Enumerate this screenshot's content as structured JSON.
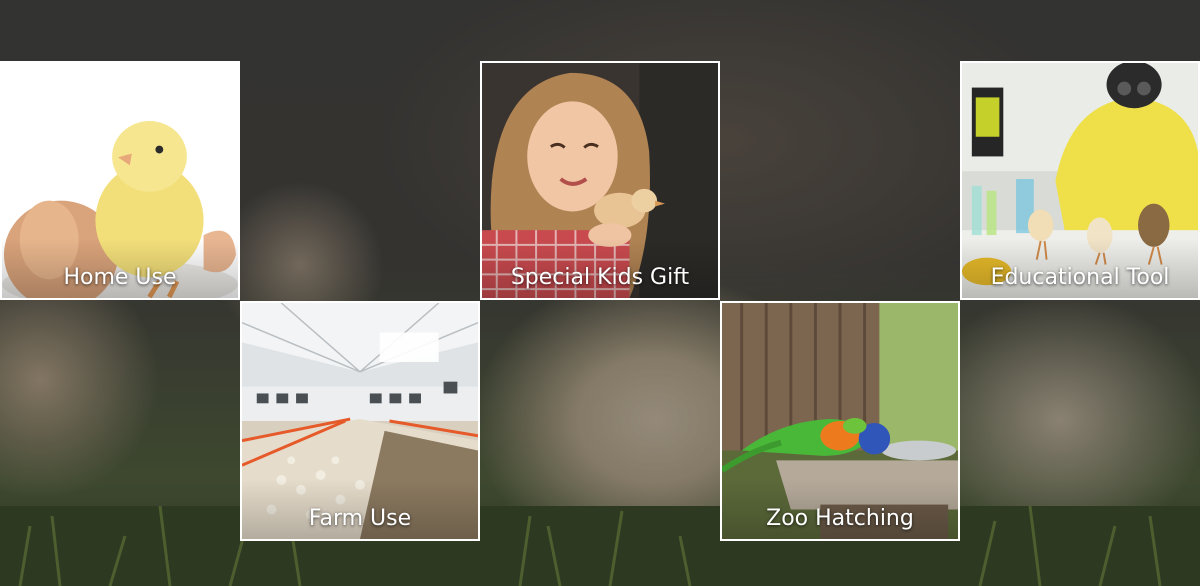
{
  "tiles": {
    "home": {
      "label": "Home Use"
    },
    "kids": {
      "label": "Special Kids Gift"
    },
    "edu": {
      "label": "Educational Tool"
    },
    "farm": {
      "label": "Farm Use"
    },
    "zoo": {
      "label": "Zoo Hatching"
    }
  }
}
